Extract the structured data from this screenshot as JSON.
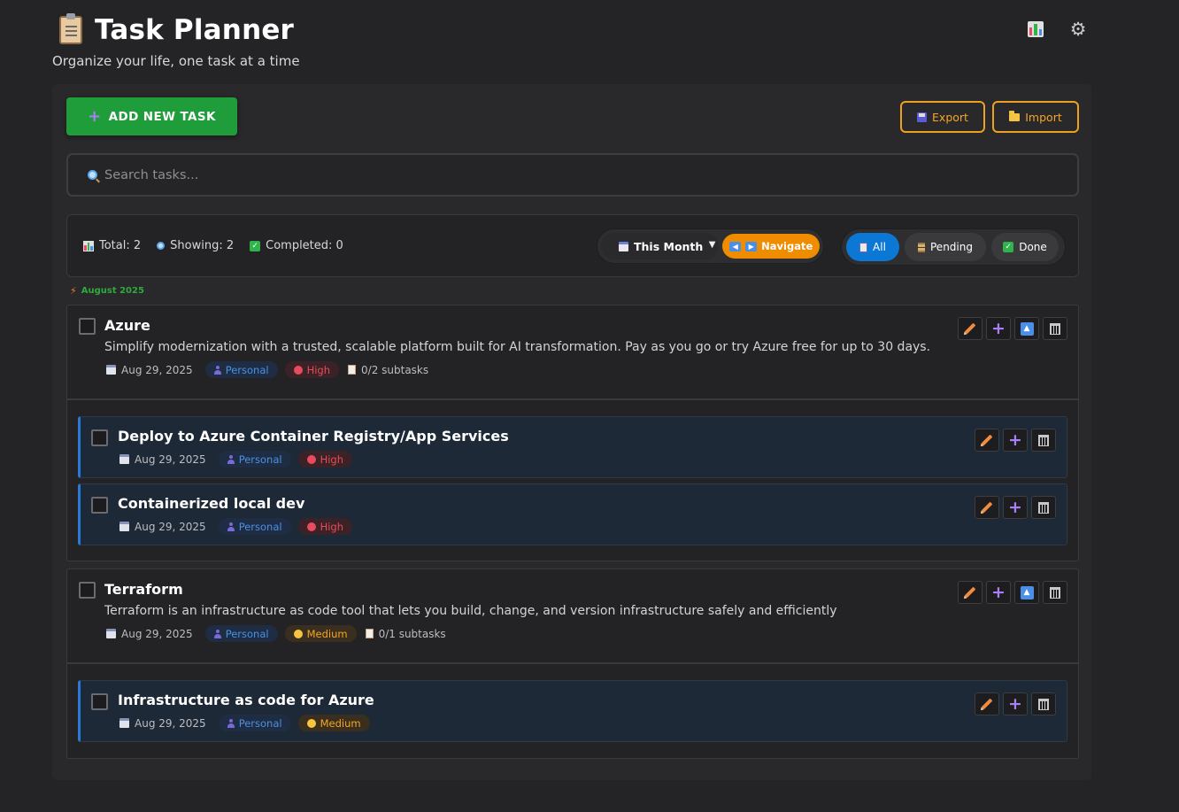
{
  "app": {
    "title": "Task Planner",
    "subtitle": "Organize your life, one task at a time",
    "header_icons": [
      "bar-chart-icon",
      "gear-icon"
    ]
  },
  "toolbar": {
    "add_label": "ADD NEW TASK",
    "export_label": "Export",
    "import_label": "Import"
  },
  "search": {
    "placeholder": "Search tasks..."
  },
  "stats": {
    "total": "Total: 2",
    "showing": "Showing: 2",
    "completed": "Completed: 0"
  },
  "filters": {
    "period": "This Month",
    "navigate_label": "Navigate",
    "status": [
      "All",
      "Pending",
      "Done"
    ],
    "active_status": "All"
  },
  "month_label": "August 2025",
  "tasks": [
    {
      "title": "Azure",
      "description": "Simplify modernization with a trusted, scalable platform built for AI transformation. Pay as you go or try Azure free for up to 30 days.",
      "date": "Aug 29, 2025",
      "category": "Personal",
      "priority": "High",
      "subtasks_label": "0/2 subtasks",
      "subtasks": [
        {
          "title": "Deploy to Azure Container Registry/App Services",
          "date": "Aug 29, 2025",
          "category": "Personal",
          "priority": "High"
        },
        {
          "title": "Containerized local dev",
          "date": "Aug 29, 2025",
          "category": "Personal",
          "priority": "High"
        }
      ]
    },
    {
      "title": "Terraform",
      "description": "Terraform is an infrastructure as code tool that lets you build, change, and version infrastructure safely and efficiently",
      "date": "Aug 29, 2025",
      "category": "Personal",
      "priority": "Medium",
      "subtasks_label": "0/1 subtasks",
      "subtasks": [
        {
          "title": "Infrastructure as code for Azure",
          "date": "Aug 29, 2025",
          "category": "Personal",
          "priority": "Medium"
        }
      ]
    }
  ],
  "colors": {
    "background": "#242426",
    "add_button": "#1f9d3a",
    "accent_orange": "#f08c00",
    "active_filter": "#0a78d4",
    "subtask_border": "#2a7bd8",
    "priority_high": "#e94b5a",
    "priority_medium": "#f5a623",
    "category_personal": "#4a90e2"
  }
}
